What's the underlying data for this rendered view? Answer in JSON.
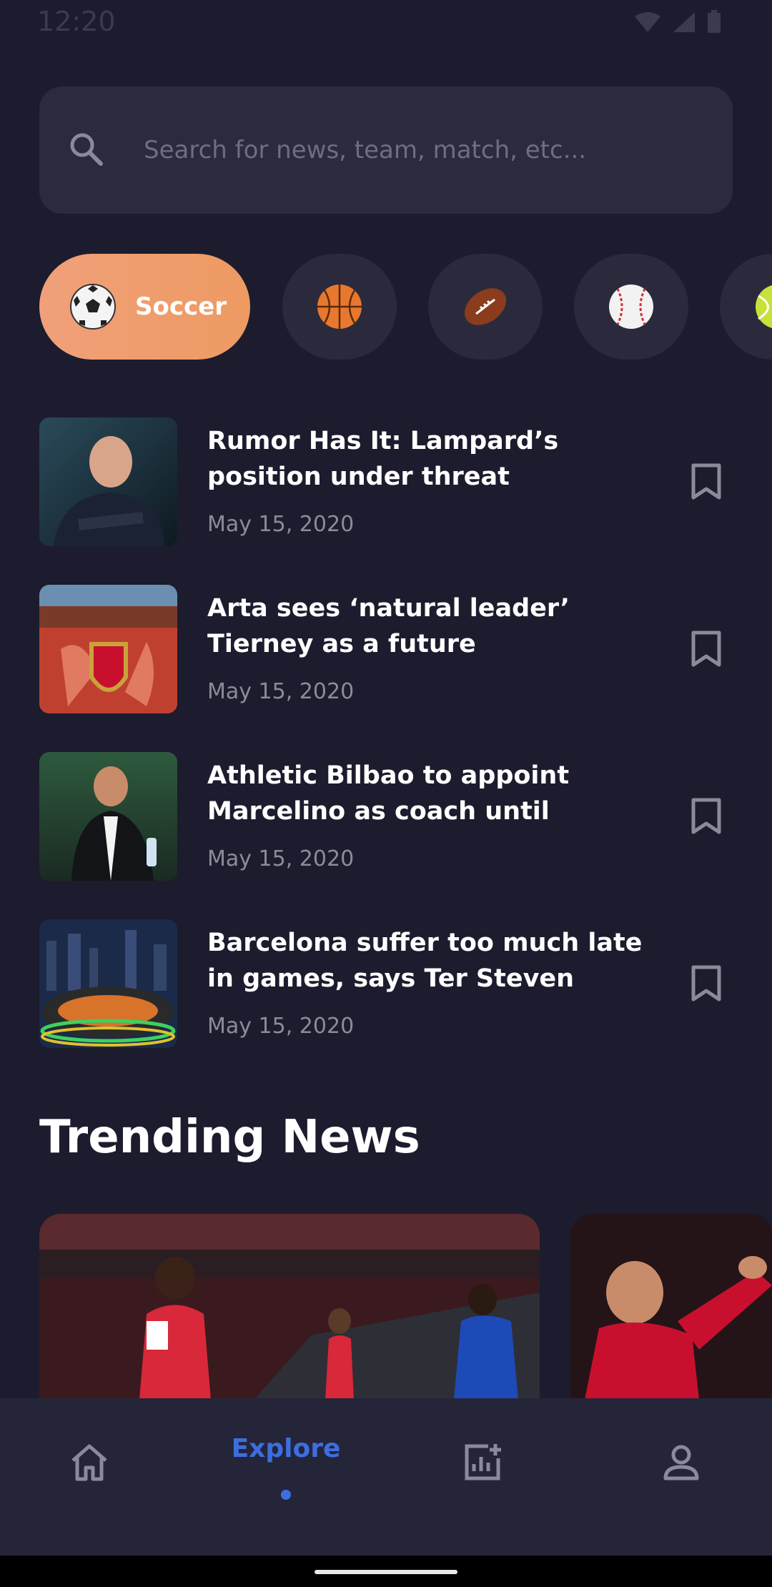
{
  "status_bar": {
    "time": "12:20"
  },
  "search": {
    "placeholder": "Search for news, team, match, etc..."
  },
  "sports_chips": [
    {
      "label": "Soccer",
      "icon": "soccer-ball-icon",
      "active": true
    },
    {
      "label": "",
      "icon": "basketball-icon",
      "active": false
    },
    {
      "label": "",
      "icon": "football-icon",
      "active": false
    },
    {
      "label": "",
      "icon": "baseball-icon",
      "active": false
    },
    {
      "label": "",
      "icon": "tennis-ball-icon",
      "active": false
    }
  ],
  "news": [
    {
      "title": "Rumor Has It: Lampard’s position under threat",
      "date": "May 15, 2020"
    },
    {
      "title": "Arta sees ‘natural leader’ Tierney as a future",
      "date": "May 15, 2020"
    },
    {
      "title": "Athletic Bilbao to appoint Marcelino as coach until",
      "date": "May 15, 2020"
    },
    {
      "title": "Barcelona suffer too much late in games, says Ter Steven",
      "date": "May 15, 2020"
    }
  ],
  "trending": {
    "title": "Trending News"
  },
  "bottom_nav": {
    "items": [
      {
        "label": "",
        "icon": "home-icon"
      },
      {
        "label": "Explore",
        "icon": "explore",
        "active": true
      },
      {
        "label": "",
        "icon": "stats-icon"
      },
      {
        "label": "",
        "icon": "profile-icon"
      }
    ]
  },
  "colors": {
    "background": "#1c1c2e",
    "surface": "#2b2b3d",
    "accent_orange": "#ee9a62",
    "accent_blue": "#3d6ee0"
  }
}
